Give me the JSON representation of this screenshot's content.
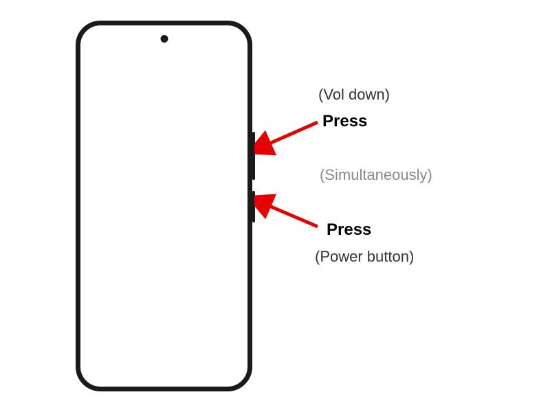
{
  "labels": {
    "vol_down": "(Vol down)",
    "press_1": "Press",
    "simultaneously": "(Simultaneously)",
    "press_2": "Press",
    "power": "(Power button)"
  },
  "arrows": {
    "color": "#e60000"
  }
}
